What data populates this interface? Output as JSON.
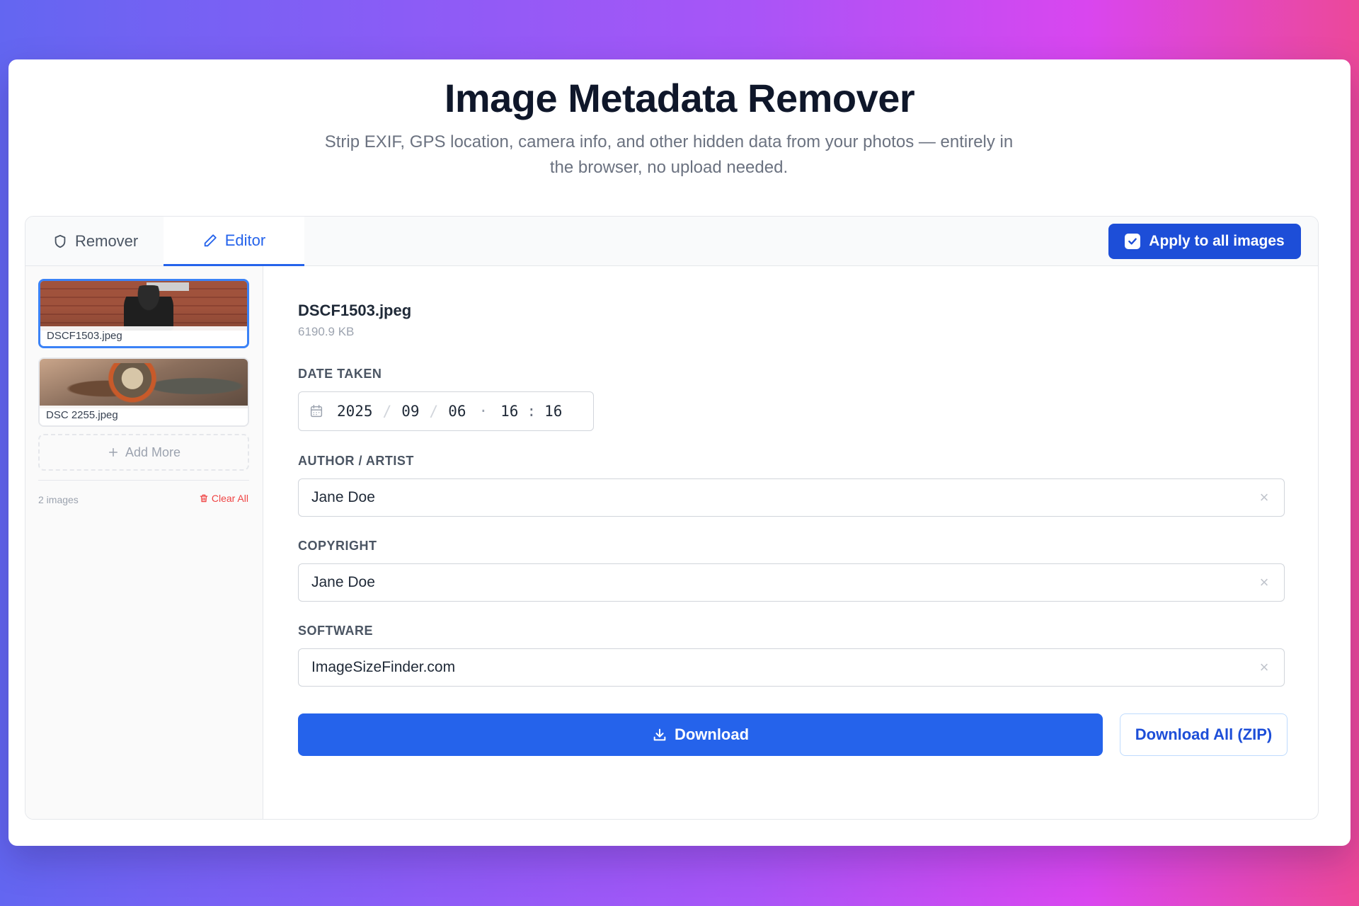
{
  "header": {
    "title": "Image Metadata Remover",
    "subtitle": "Strip EXIF, GPS location, camera info, and other hidden data from your photos — entirely in the browser, no upload needed."
  },
  "tabs": {
    "remover_label": "Remover",
    "editor_label": "Editor",
    "active": "Editor"
  },
  "apply_all": {
    "label": "Apply to all images",
    "checked": true
  },
  "sidebar": {
    "images": [
      {
        "name": "DSCF1503.jpeg",
        "selected": true
      },
      {
        "name": "DSC 2255.jpeg",
        "selected": false
      }
    ],
    "add_more_label": "Add More",
    "count_label": "2 images",
    "clear_all_label": "Clear All"
  },
  "editor": {
    "file_name": "DSCF1503.jpeg",
    "file_size": "6190.9 KB",
    "date_taken": {
      "label": "DATE TAKEN",
      "year": "2025",
      "month": "09",
      "day": "06",
      "hour": "16",
      "minute": "16"
    },
    "author": {
      "label": "AUTHOR / ARTIST",
      "value": "Jane Doe"
    },
    "copyright": {
      "label": "COPYRIGHT",
      "value": "Jane Doe"
    },
    "software": {
      "label": "SOFTWARE",
      "value": "ImageSizeFinder.com"
    }
  },
  "actions": {
    "download_label": "Download",
    "download_all_label": "Download All (ZIP)"
  },
  "colors": {
    "accent": "#2563eb",
    "danger": "#ef4444"
  }
}
